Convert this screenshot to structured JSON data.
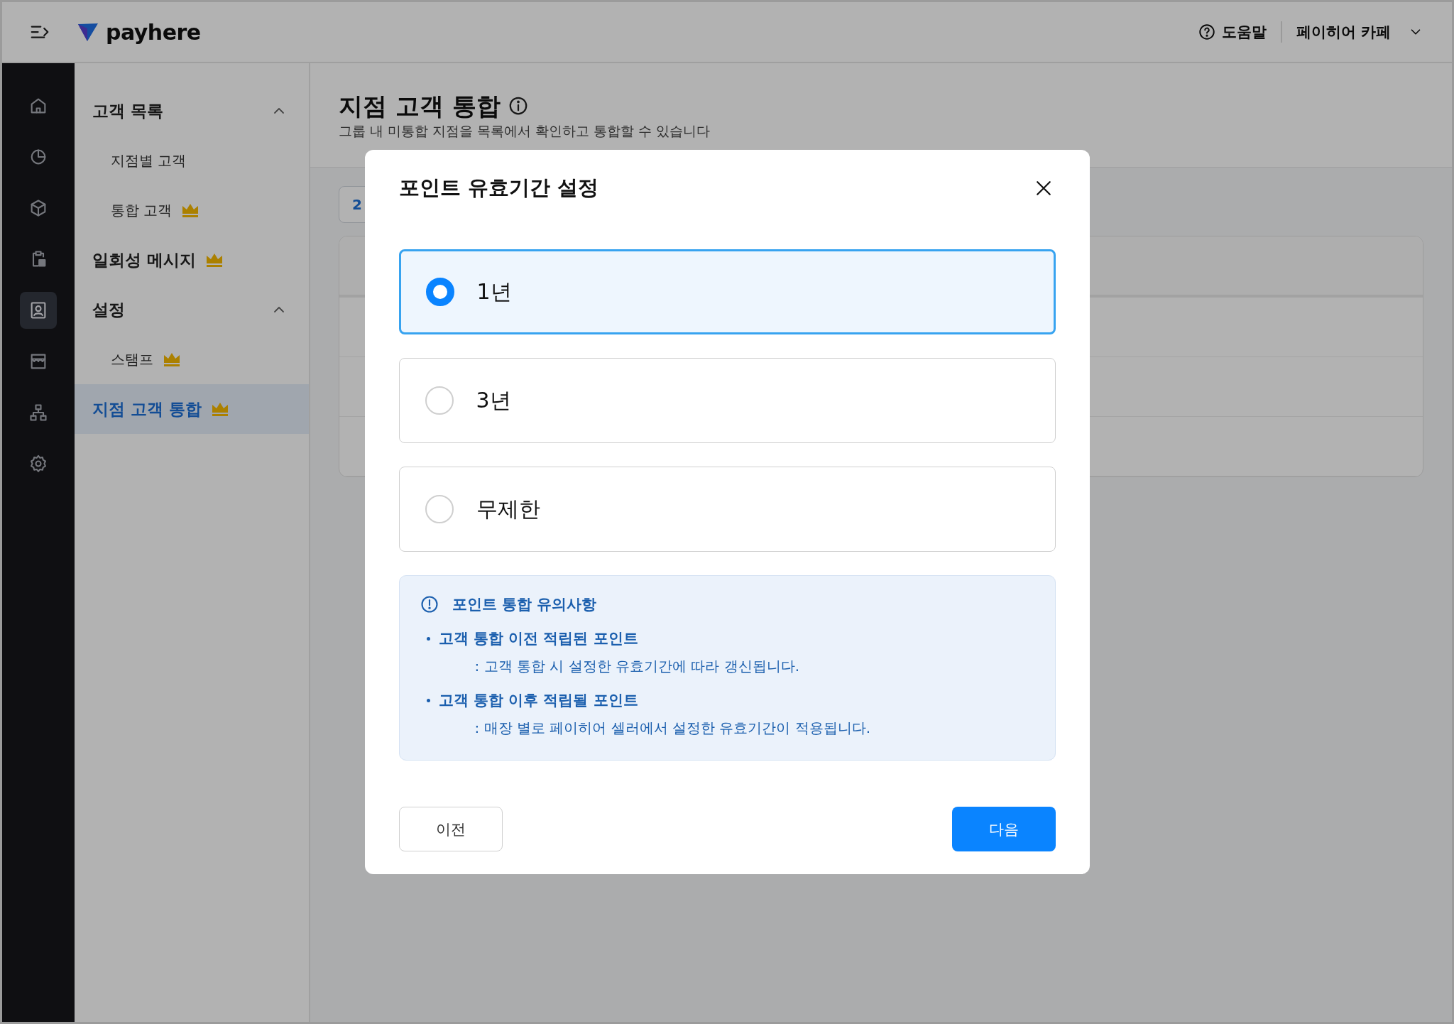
{
  "header": {
    "logo": "payhere",
    "help": "도움말",
    "store": "페이히어 카페"
  },
  "rail": [
    {
      "kind": "home",
      "selected": false
    },
    {
      "kind": "chart",
      "selected": false
    },
    {
      "kind": "box",
      "selected": false
    },
    {
      "kind": "clipboard",
      "selected": false
    },
    {
      "kind": "customer",
      "selected": true
    },
    {
      "kind": "store",
      "selected": false
    },
    {
      "kind": "network",
      "selected": false
    },
    {
      "kind": "settings",
      "selected": false
    }
  ],
  "menu": [
    {
      "label": "고객 목록",
      "premium": false,
      "selected": false,
      "expanded": true,
      "children": [
        {
          "label": "지점별 고객",
          "premium": false,
          "selected": false
        },
        {
          "label": "통합 고객",
          "premium": true,
          "selected": false
        }
      ]
    },
    {
      "label": "일회성 메시지",
      "premium": true,
      "selected": false
    },
    {
      "label": "설정",
      "premium": false,
      "selected": false,
      "expanded": true,
      "children": [
        {
          "label": "스탬프",
          "premium": true,
          "selected": false
        }
      ]
    },
    {
      "label": "지점 고객 통합",
      "premium": true,
      "selected": true
    }
  ],
  "page": {
    "title": "지점 고객 통합",
    "subtitle": "그룹 내 미통합 지점을 목록에서 확인하고 통합할 수 있습니다",
    "chip": "2"
  },
  "modal": {
    "title": "포인트 유효기간 설정",
    "options": [
      {
        "label": "1년",
        "selected": true
      },
      {
        "label": "3년",
        "selected": false
      },
      {
        "label": "무제한",
        "selected": false
      }
    ],
    "notice": {
      "title": "포인트 통합 유의사항",
      "items": [
        {
          "heading": "고객 통합 이전 적립된 포인트",
          "detail": ": 고객 통합 시 설정한 유효기간에 따라 갱신됩니다."
        },
        {
          "heading": "고객 통합 이후 적립될 포인트",
          "detail": ": 매장 별로 페이히어 셀러에서 설정한 유효기간이 적용됩니다."
        }
      ]
    },
    "buttons": [
      {
        "label": "이전",
        "kind": "secondary"
      },
      {
        "label": "다음",
        "kind": "primary"
      }
    ]
  }
}
